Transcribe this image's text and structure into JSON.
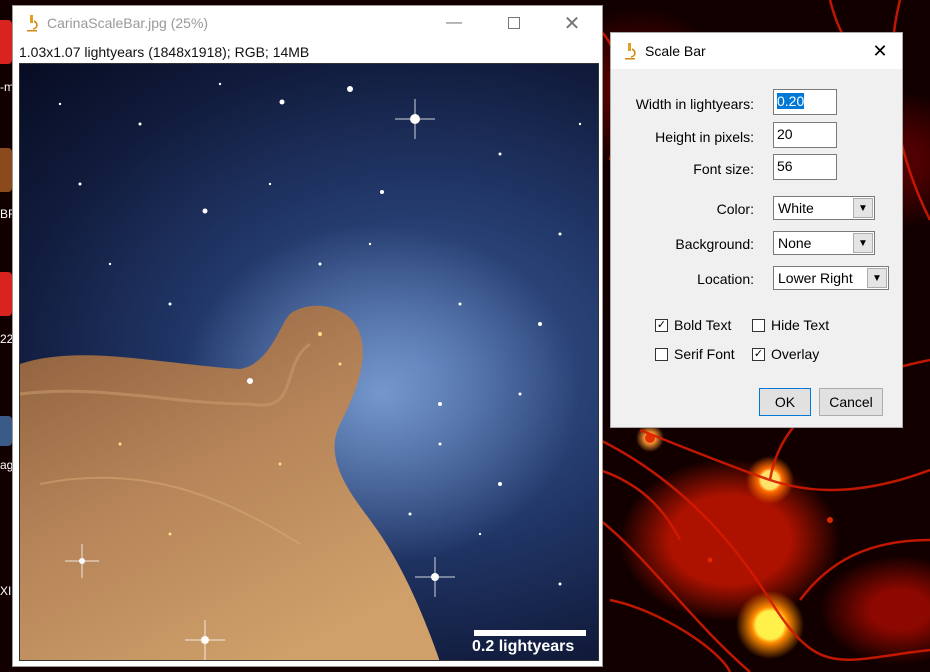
{
  "image_window": {
    "title": "CarinaScaleBar.jpg (25%)",
    "info": "1.03x1.07 lightyears (1848x1918); RGB; 14MB",
    "scale_bar_label": "0.2 lightyears"
  },
  "dialog": {
    "title": "Scale Bar",
    "width_label": "Width in lightyears:",
    "width_value": "0.20",
    "height_label": "Height in pixels:",
    "height_value": "20",
    "font_size_label": "Font size:",
    "font_size_value": "56",
    "color_label": "Color:",
    "color_value": "White",
    "background_label": "Background:",
    "background_value": "None",
    "location_label": "Location:",
    "location_value": "Lower Right",
    "bold_text_label": "Bold Text",
    "bold_text_checked": true,
    "hide_text_label": "Hide Text",
    "hide_text_checked": false,
    "serif_font_label": "Serif Font",
    "serif_font_checked": false,
    "overlay_label": "Overlay",
    "overlay_checked": true,
    "ok_label": "OK",
    "cancel_label": "Cancel"
  },
  "desktop": {
    "icon_labels": [
      "-m",
      "BF",
      "22",
      "ag",
      "XI"
    ]
  },
  "colors": {
    "selection": "#0078d7",
    "desktop_red": "#c41400"
  }
}
